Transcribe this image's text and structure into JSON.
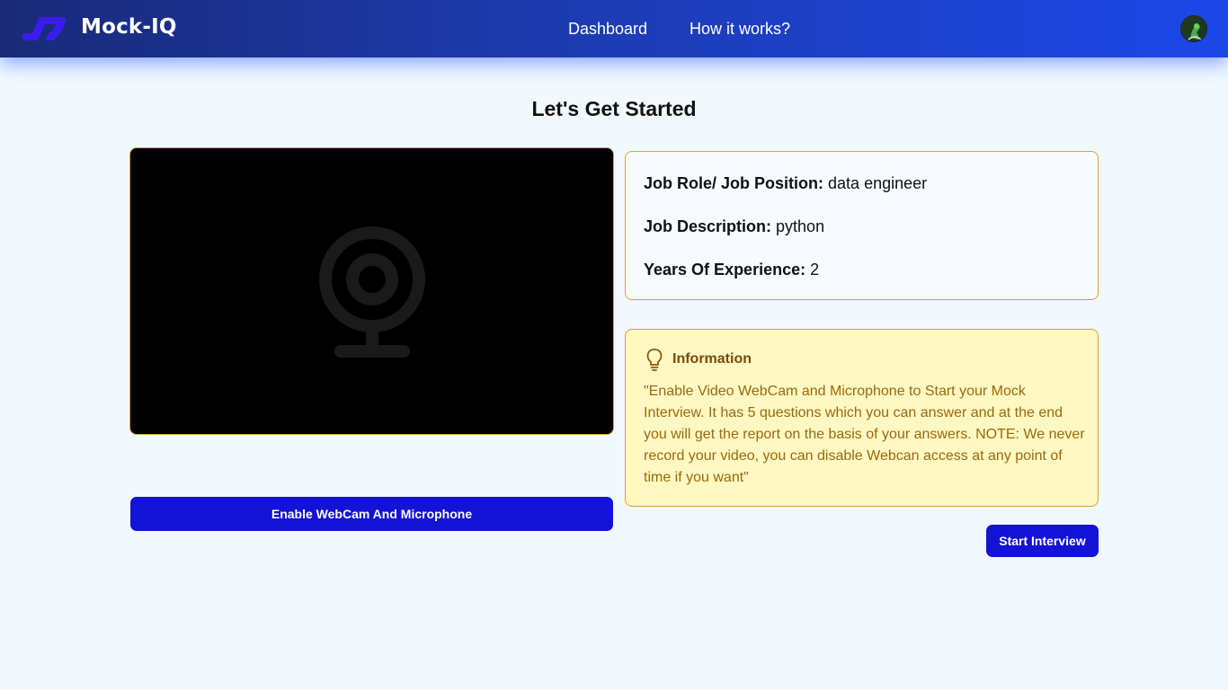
{
  "header": {
    "brand": "Mock-IQ",
    "nav": [
      {
        "label": "Dashboard"
      },
      {
        "label": "How it works?"
      }
    ]
  },
  "page": {
    "title": "Let's Get Started"
  },
  "webcam": {
    "enable_button_label": "Enable WebCam And Microphone"
  },
  "details": {
    "job_role_label": "Job Role/ Job Position:",
    "job_role_value": "data engineer",
    "job_description_label": "Job Description:",
    "job_description_value": "python",
    "experience_label": "Years Of Experience:",
    "experience_value": "2"
  },
  "info": {
    "title": "Information",
    "text": "\"Enable Video WebCam and Microphone to Start your Mock Interview. It has 5 questions which you can answer and at the end you will get the report on the basis of your answers. NOTE: We never record your video, you can disable Webcan access at any point of time if you want\""
  },
  "actions": {
    "start_label": "Start Interview"
  },
  "colors": {
    "header_start": "#1a2a78",
    "header_end": "#1c47e8",
    "primary_button": "#1313d6",
    "card_border": "#d9a528",
    "info_bg": "#fef8c2",
    "info_text": "#9a6a10",
    "page_bg": "#f2f9fe"
  },
  "icons": {
    "logo": "logo-icon",
    "webcam": "webcam-icon",
    "info": "lightbulb-icon",
    "avatar": "avatar"
  }
}
